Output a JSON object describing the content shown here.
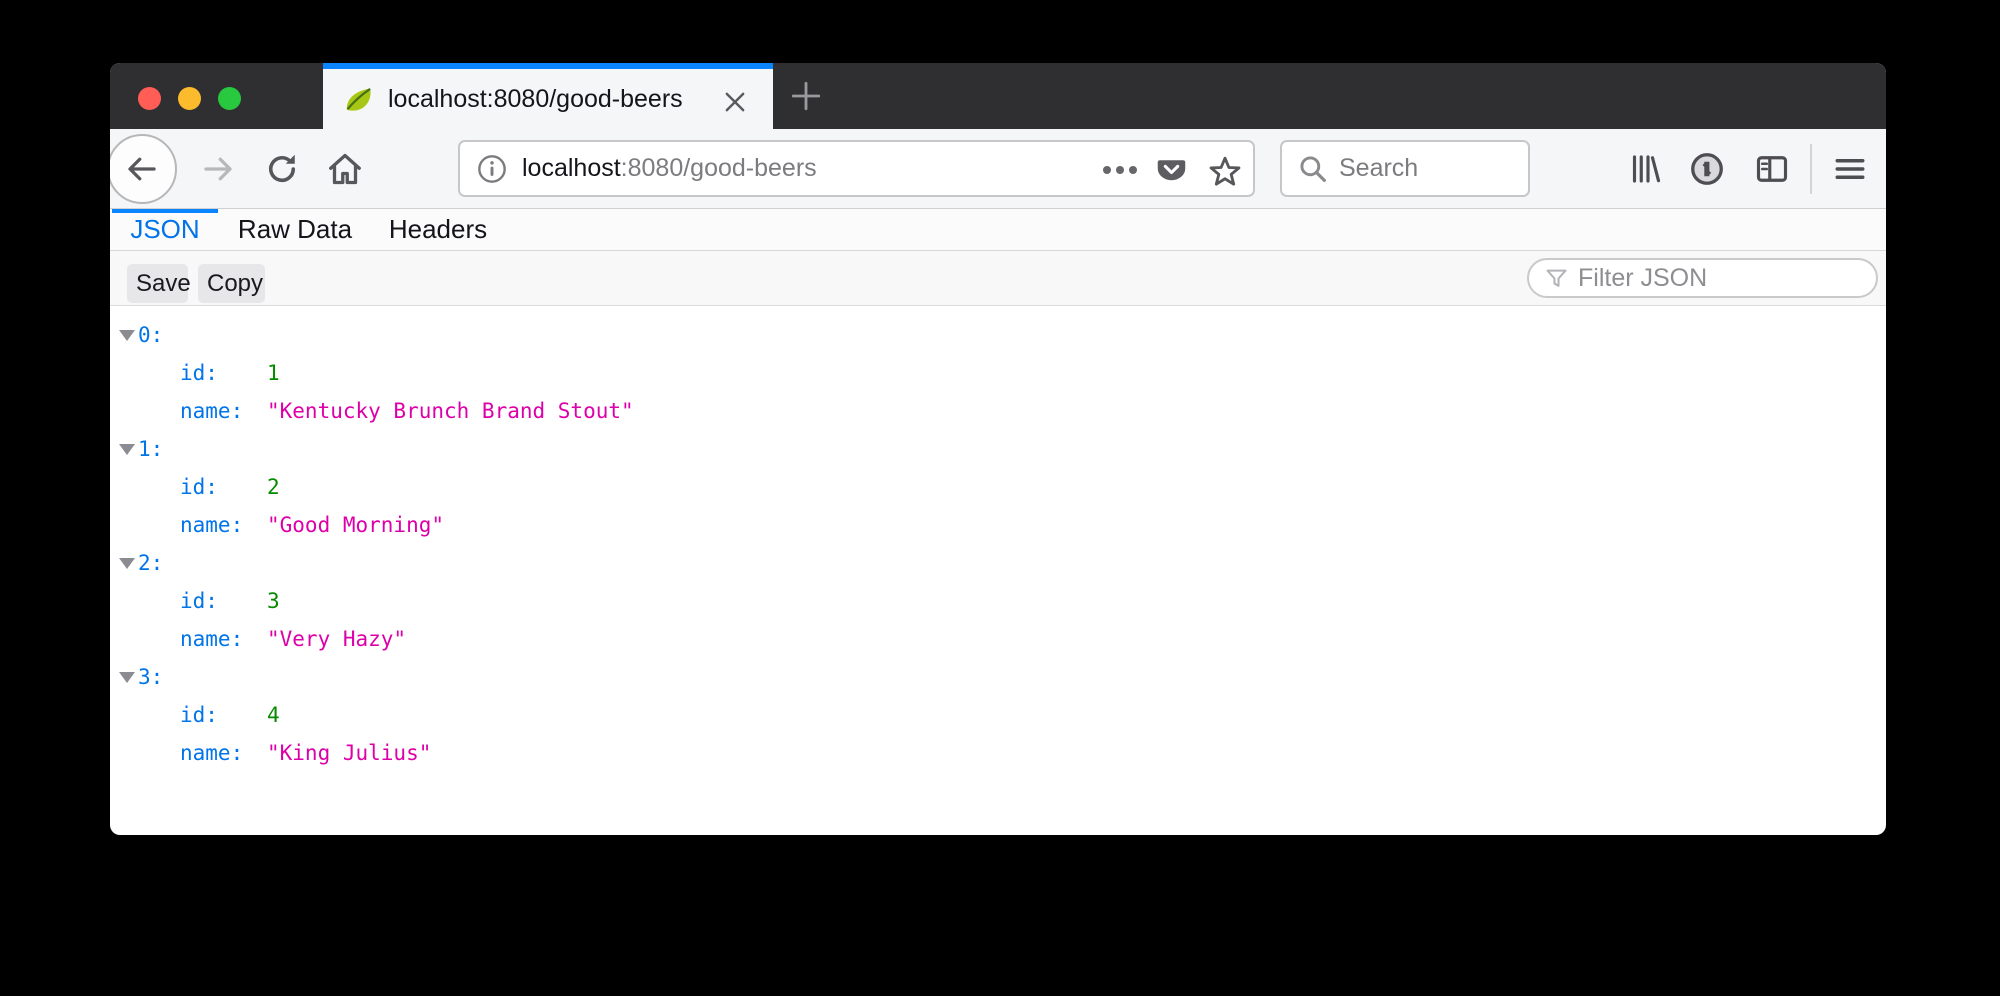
{
  "window": {
    "traffic_lights": {
      "close": "close",
      "minimize": "minimize",
      "zoom": "zoom"
    },
    "tab": {
      "title": "localhost:8080/good-beers"
    },
    "toolbar": {
      "url_host": "localhost",
      "url_rest": ":8080/good-beers",
      "search_placeholder": "Search"
    }
  },
  "viewer": {
    "tabs": [
      {
        "label": "JSON",
        "active": true
      },
      {
        "label": "Raw Data",
        "active": false
      },
      {
        "label": "Headers",
        "active": false
      }
    ],
    "toolbar": {
      "save_label": "Save",
      "copy_label": "Copy",
      "filter_placeholder": "Filter JSON"
    },
    "entries": [
      {
        "index": "0:",
        "id_key": "id:",
        "id_value": "1",
        "name_key": "name:",
        "name_value": "\"Kentucky Brunch Brand Stout\""
      },
      {
        "index": "1:",
        "id_key": "id:",
        "id_value": "2",
        "name_key": "name:",
        "name_value": "\"Good Morning\""
      },
      {
        "index": "2:",
        "id_key": "id:",
        "id_value": "3",
        "name_key": "name:",
        "name_value": "\"Very Hazy\""
      },
      {
        "index": "3:",
        "id_key": "id:",
        "id_value": "4",
        "name_key": "name:",
        "name_value": "\"King Julius\""
      }
    ],
    "colors": {
      "accent_blue": "#0a84ff",
      "key_blue": "#0074e8",
      "number_green": "#058b00",
      "string_magenta": "#dd00a9"
    }
  }
}
